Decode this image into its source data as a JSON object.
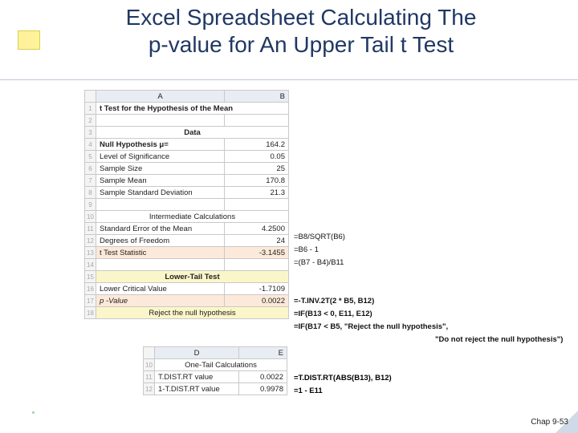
{
  "title_line1": "Excel Spreadsheet Calculating The",
  "title_line2": "p-value for An Upper Tail t Test",
  "cols": {
    "A": "A",
    "B": "B",
    "D": "D",
    "E": "E"
  },
  "rows": {
    "r1": "1",
    "r2": "2",
    "r3": "3",
    "r4": "4",
    "r5": "5",
    "r6": "6",
    "r7": "7",
    "r8": "8",
    "r9": "9",
    "r10": "10",
    "r11": "11",
    "r12": "12",
    "r13": "13",
    "r14": "14",
    "r15": "15",
    "r16": "16",
    "r17": "17",
    "r18": "18"
  },
  "t1": {
    "title": "t Test for the Hypothesis of the Mean",
    "data_header": "Data",
    "null_label": "Null Hypothesis            μ=",
    "null_val": "164.2",
    "sig_label": "Level of Significance",
    "sig_val": "0.05",
    "n_label": "Sample Size",
    "n_val": "25",
    "mean_label": "Sample Mean",
    "mean_val": "170.8",
    "sd_label": "Sample Standard Deviation",
    "sd_val": "21.3",
    "inter_header": "Intermediate Calculations",
    "se_label": "Standard Error of the Mean",
    "se_val": "4.2500",
    "df_label": "Degrees of Freedom",
    "df_val": "24",
    "tstat_label": "t Test Statistic",
    "tstat_val": "-3.1455",
    "lower_header": "Lower-Tail Test",
    "lcv_label": "Lower Critical Value",
    "lcv_val": "-1.7109",
    "p_label": "p -Value",
    "p_val": "0.0022",
    "reject": "Reject the null hypothesis"
  },
  "f": {
    "se": "=B8/SQRT(B6)",
    "df": "=B6 - 1",
    "tstat": "=(B7 - B4)/B11",
    "lcv": "=-T.INV.2T(2 * B5, B12)",
    "p": "=IF(B13 < 0, E11, E12)",
    "reject1": "=IF(B17 < B5, \"Reject the null hypothesis\",",
    "reject2": "\"Do not reject the null hypothesis\")"
  },
  "t2": {
    "header": "One-Tail Calculations",
    "r1_label": "T.DIST.RT value",
    "r1_val": "0.0022",
    "r2_label": "1-T.DIST.RT value",
    "r2_val": "0.9978"
  },
  "f2": {
    "r1": "=T.DIST.RT(ABS(B13), B12)",
    "r2": "=1 - E11"
  },
  "footer": "Chap 9-53"
}
